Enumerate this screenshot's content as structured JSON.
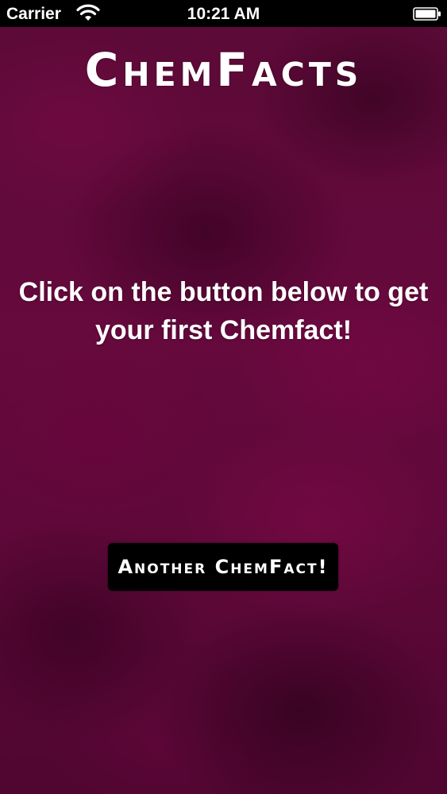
{
  "status_bar": {
    "carrier": "Carrier",
    "time": "10:21 AM",
    "wifi_icon": "wifi-icon",
    "battery_icon": "battery-icon"
  },
  "app": {
    "title": "ChemFacts",
    "prompt": "Click on the button below to get your first Chemfact!",
    "button_label": "Another ChemFact!"
  },
  "colors": {
    "background": "#5a0a35",
    "button": "#000000",
    "text": "#ffffff"
  }
}
